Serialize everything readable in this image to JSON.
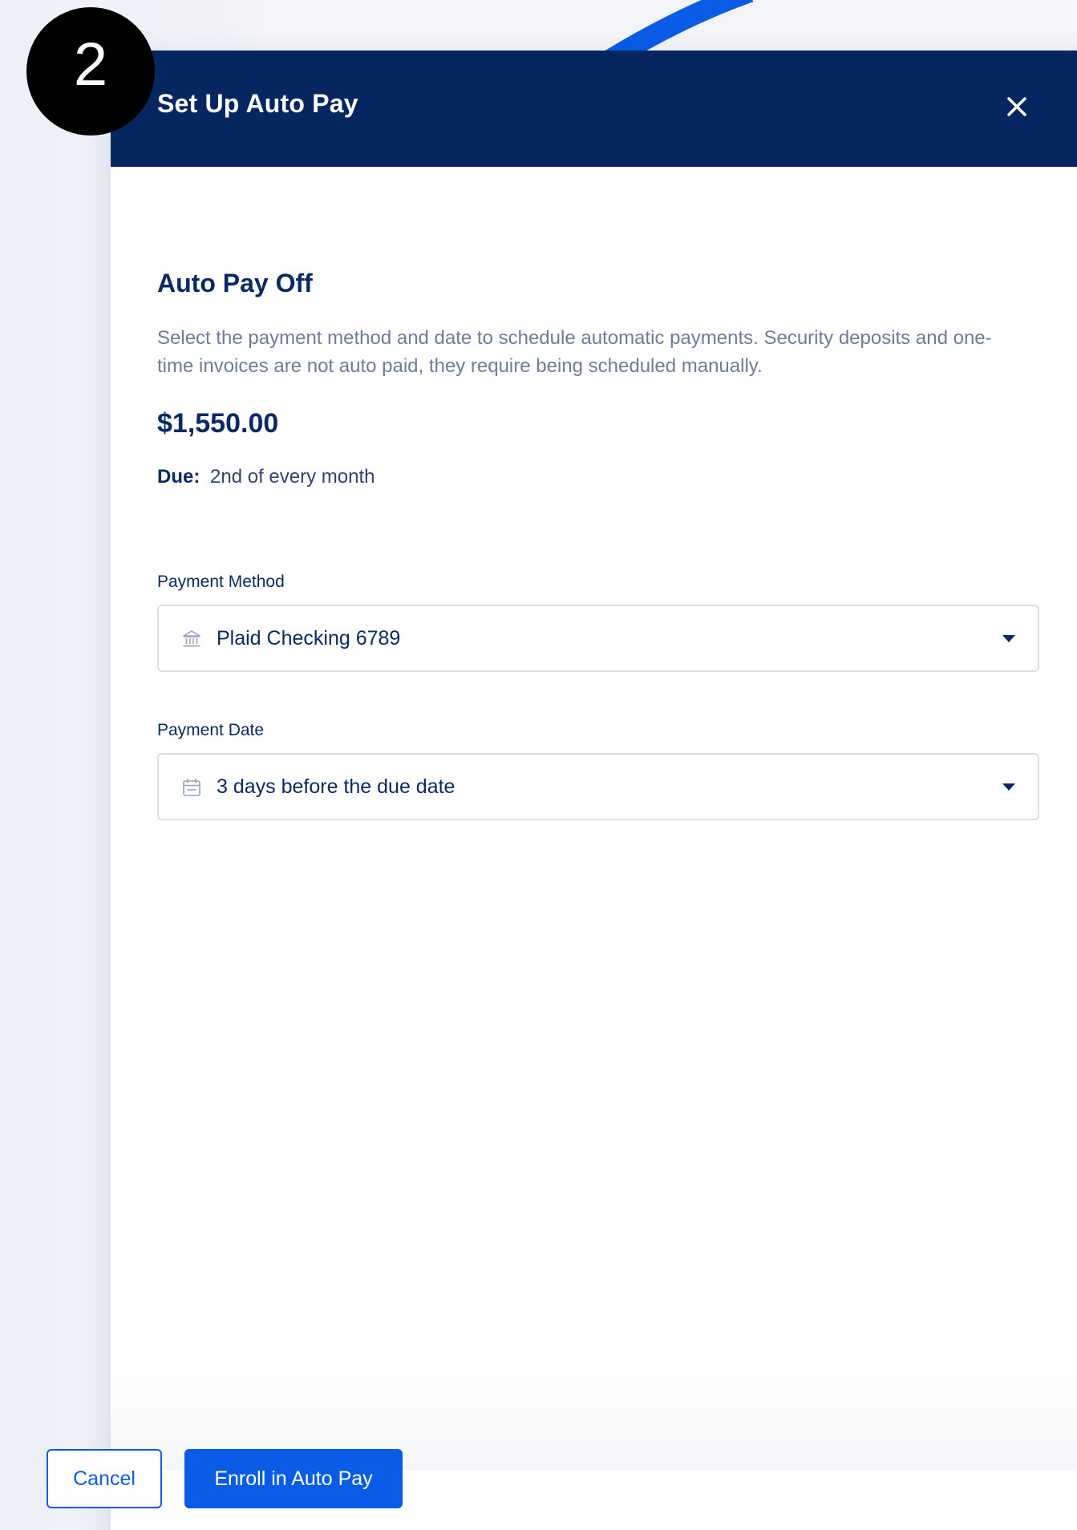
{
  "step_badge": "2",
  "modal": {
    "title": "Set Up Auto Pay",
    "close_icon": "close-icon",
    "section_title": "Auto Pay Off",
    "description": "Select the payment method and date to schedule automatic payments. Security deposits and one-time invoices are not auto paid, they require being scheduled manually.",
    "amount": "$1,550.00",
    "due_label": "Due:",
    "due_value": "2nd of every month",
    "payment_method": {
      "label": "Payment Method",
      "icon": "bank-icon",
      "value": "Plaid Checking 6789"
    },
    "payment_date": {
      "label": "Payment Date",
      "icon": "calendar-icon",
      "value": "3 days before the due date"
    },
    "buttons": {
      "cancel": "Cancel",
      "enroll": "Enroll in Auto Pay"
    }
  },
  "colors": {
    "header_bg": "#062660",
    "primary": "#0a5ce6",
    "heading_text": "#0a2a66",
    "muted_text": "#6d7c97",
    "border": "#d9dee8"
  }
}
